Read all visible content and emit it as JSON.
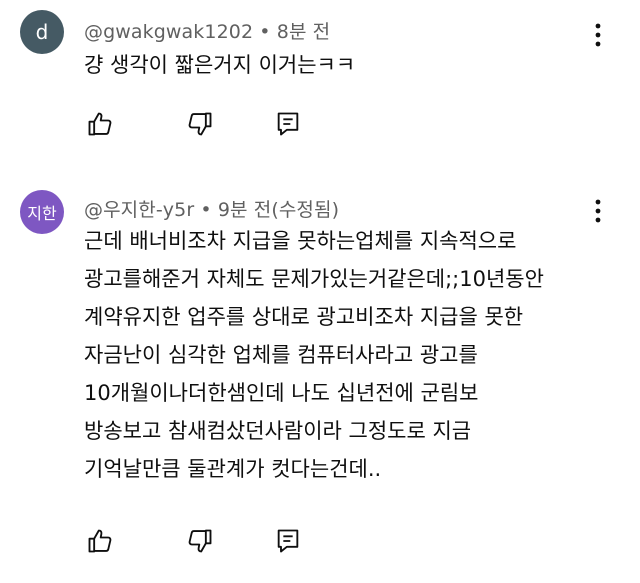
{
  "comments": [
    {
      "avatar_letter": "d",
      "avatar_color": "#455a64",
      "author": "@gwakgwak1202",
      "separator": "•",
      "time": "8분 전",
      "lines": [
        "걍 생각이 짧은거지 이거는ㅋㅋ"
      ]
    },
    {
      "avatar_letter": "지한",
      "avatar_color": "#7e57c2",
      "author": "@우지한-y5r",
      "separator": "•",
      "time": "9분 전(수정됨)",
      "lines": [
        "근데 배너비조차 지급을 못하는업체를 지속적으로",
        "광고를해준거 자체도 문제가있는거같은데;;10년동안",
        "계약유지한 업주를 상대로 광고비조차 지급을 못한",
        "자금난이 심각한 업체를 컴퓨터사라고 광고를",
        "10개월이나더한샘인데 나도 십년전에 군림보",
        "방송보고 참새컴샀던사람이라 그정도로 지금",
        "기억날만큼 둘관계가 컷다는건데.."
      ]
    }
  ],
  "icons": {
    "like": "thumbs-up-icon",
    "dislike": "thumbs-down-icon",
    "reply": "reply-comment-icon",
    "more": "more-vertical-icon"
  }
}
